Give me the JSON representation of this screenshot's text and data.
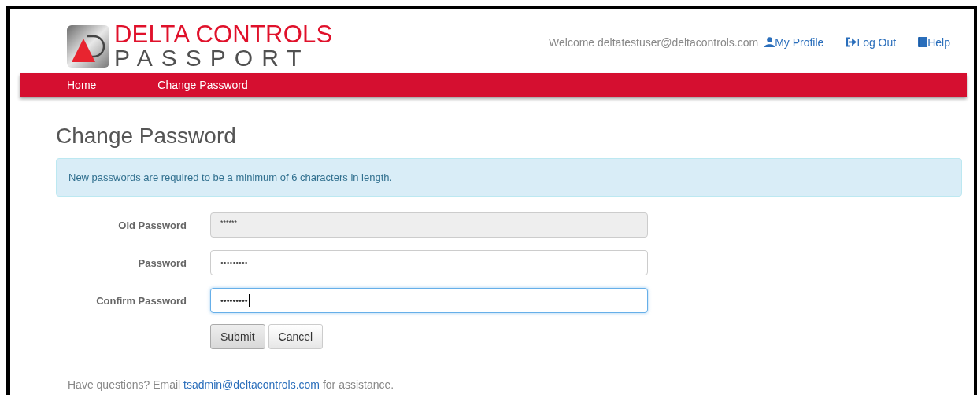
{
  "logo": {
    "brand": "DELTA CONTROLS",
    "product": "PASSPORT"
  },
  "header": {
    "welcome": "Welcome deltatestuser@deltacontrols.com",
    "links": [
      {
        "kind": "profile",
        "label": "My Profile"
      },
      {
        "kind": "logout",
        "label": "Log Out"
      },
      {
        "kind": "help",
        "label": "Help"
      }
    ]
  },
  "nav": [
    {
      "label": "Home"
    },
    {
      "label": "Change Password"
    }
  ],
  "page_title": "Change Password",
  "info_alert": "New passwords are required to be a minimum of 6 characters in length.",
  "form": [
    {
      "label": "Old Password",
      "value": "******",
      "disabled": true,
      "focused": false
    },
    {
      "label": "Password",
      "value": "•••••••••",
      "disabled": false,
      "focused": false
    },
    {
      "label": "Confirm Password",
      "value": "•••••••••",
      "disabled": false,
      "focused": true
    }
  ],
  "buttons": [
    {
      "label": "Submit",
      "kind": "primary"
    },
    {
      "label": "Cancel",
      "kind": "default"
    }
  ],
  "footer": {
    "prefix": "Have questions? Email ",
    "link": "tsadmin@deltacontrols.com",
    "suffix": " for assistance."
  }
}
